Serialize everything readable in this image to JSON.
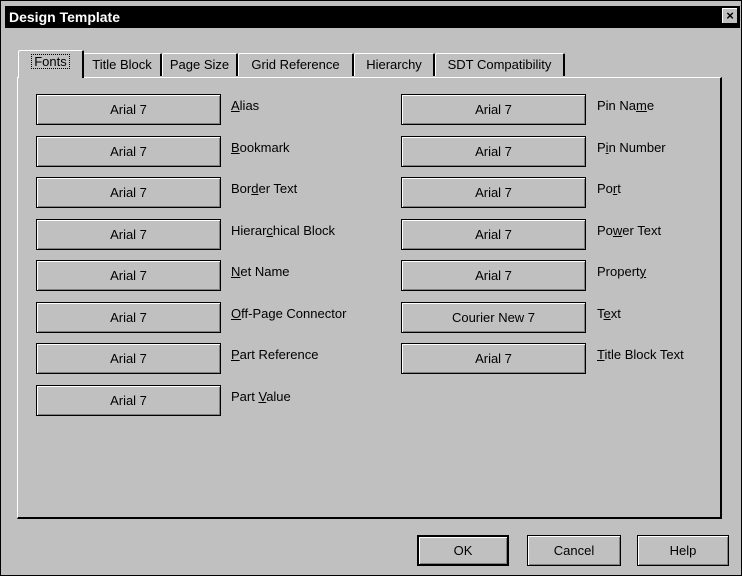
{
  "window": {
    "title": "Design Template",
    "close_glyph": "×"
  },
  "tabs": [
    {
      "label": "Fonts",
      "active": true
    },
    {
      "label": "Title Block"
    },
    {
      "label": "Page Size"
    },
    {
      "label": "Grid Reference"
    },
    {
      "label": "Hierarchy"
    },
    {
      "label": "SDT Compatibility"
    }
  ],
  "fonts_left": [
    {
      "font": "Arial 7",
      "label": "Alias",
      "mnemonic": "A"
    },
    {
      "font": "Arial 7",
      "label": "Bookmark",
      "mnemonic": "B"
    },
    {
      "font": "Arial 7",
      "label": "Border Text",
      "mnemonic": "d"
    },
    {
      "font": "Arial 7",
      "label": "Hierarchical Block",
      "mnemonic": "c"
    },
    {
      "font": "Arial 7",
      "label": "Net Name",
      "mnemonic": "N"
    },
    {
      "font": "Arial 7",
      "label": "Off-Page Connector",
      "mnemonic": "O"
    },
    {
      "font": "Arial 7",
      "label": "Part Reference",
      "mnemonic": "P"
    },
    {
      "font": "Arial 7",
      "label": "Part Value",
      "mnemonic": "V"
    }
  ],
  "fonts_right": [
    {
      "font": "Arial 7",
      "label": "Pin Name",
      "mnemonic": "m"
    },
    {
      "font": "Arial 7",
      "label": "Pin Number",
      "mnemonic": "i"
    },
    {
      "font": "Arial 7",
      "label": "Port",
      "mnemonic": "r"
    },
    {
      "font": "Arial 7",
      "label": "Power Text",
      "mnemonic": "w"
    },
    {
      "font": "Arial 7",
      "label": "Property",
      "mnemonic": "y"
    },
    {
      "font": "Courier New 7",
      "label": "Text",
      "mnemonic": "e"
    },
    {
      "font": "Arial 7",
      "label": "Title Block Text",
      "mnemonic": "T"
    }
  ],
  "buttons": {
    "ok": "OK",
    "cancel": "Cancel",
    "help": "Help"
  }
}
